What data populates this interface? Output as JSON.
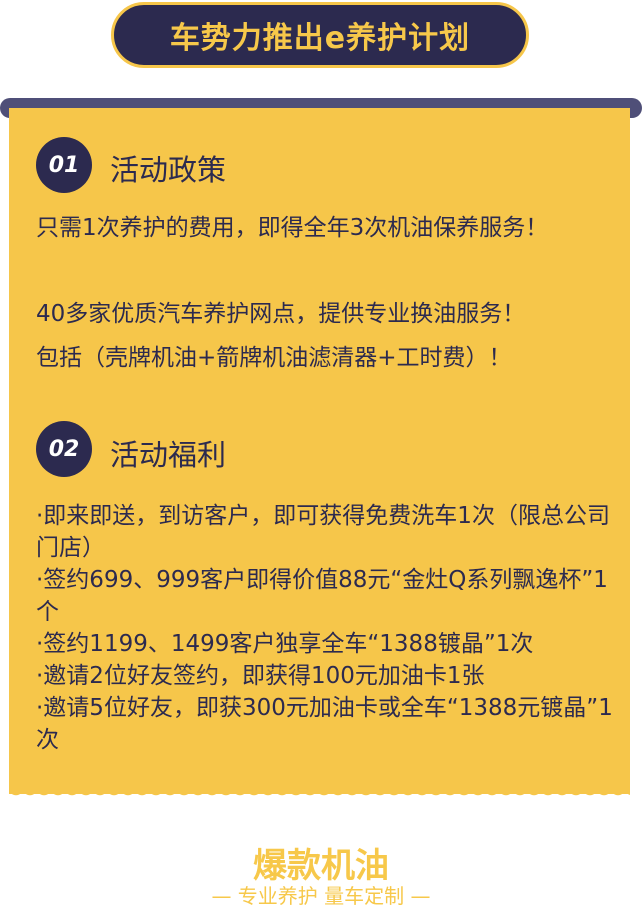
{
  "header": {
    "title": "车势力推出e养护计划"
  },
  "section1": {
    "number": "01",
    "title": "活动政策",
    "paragraphs": [
      "只需1次养护的费用，即得全年3次机油保养服务！",
      "40多家优质汽车养护网点，提供专业换油服务！",
      "包括（壳牌机油+箭牌机油滤清器+工时费）！"
    ]
  },
  "section2": {
    "number": "02",
    "title": "活动福利",
    "items": [
      "·即来即送，到访客户，即可获得免费洗车1次（限总公司门店）",
      "·签约699、999客户即得价值88元“金灶Q系列飘逸杯”1个",
      "·签约1199、1499客户独享全车“1388镀晶”1次",
      "·邀请2位好友签约，即获得100元加油卡1张",
      "·邀请5位好友，即获300元加油卡或全车“1388元镀晶”1次"
    ]
  },
  "footer": {
    "title": "爆款机油",
    "subtitle": "— 专业养护 量车定制 —"
  }
}
